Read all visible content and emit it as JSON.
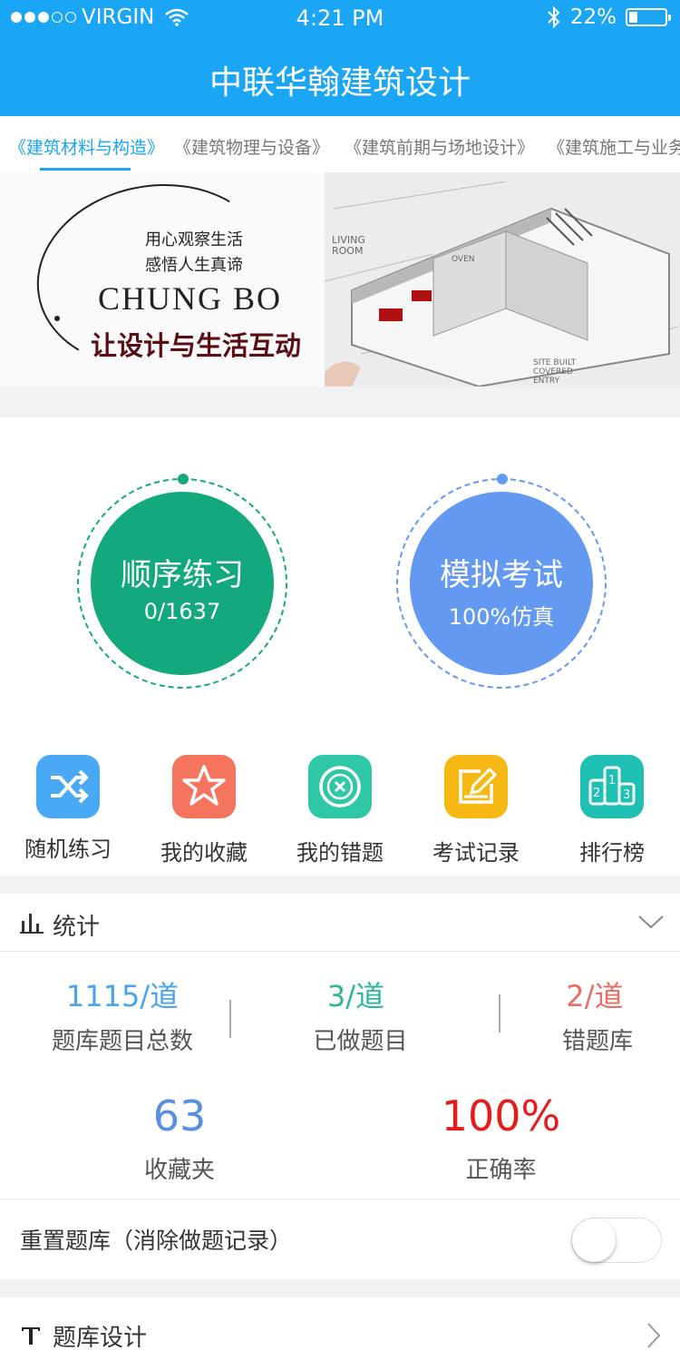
{
  "status_bar": {
    "carrier": "VIRGIN",
    "time": "4:21 PM",
    "battery": "22%"
  },
  "header": {
    "title": "中联华翰建筑设计"
  },
  "tabs": [
    {
      "label": "《建筑材料与构造》",
      "active": true
    },
    {
      "label": "《建筑物理与设备》",
      "active": false
    },
    {
      "label": "《建筑前期与场地设计》",
      "active": false
    },
    {
      "label": "《建筑施工与业务",
      "active": false
    }
  ],
  "banner": {
    "line1": "用心观察生活",
    "line2": "感悟人生真谛",
    "brand": "CHUNG BO",
    "tagline": "让设计与生活互动"
  },
  "practice": {
    "sequential": {
      "label": "顺序练习",
      "progress": "0/1637",
      "color": "#14a87e"
    },
    "mock_exam": {
      "label": "模拟考试",
      "sub": "100%仿真",
      "color": "#6399f0"
    }
  },
  "features": [
    {
      "label": "随机练习",
      "icon": "shuffle-icon",
      "color": "#4aa9f5"
    },
    {
      "label": "我的收藏",
      "icon": "star-icon",
      "color": "#f5745e"
    },
    {
      "label": "我的错题",
      "icon": "close-circle-icon",
      "color": "#2ec8a6"
    },
    {
      "label": "考试记录",
      "icon": "edit-icon",
      "color": "#f6b914"
    },
    {
      "label": "排行榜",
      "icon": "podium-icon",
      "color": "#1ec0b4"
    }
  ],
  "stats": {
    "title": "统计",
    "total": {
      "value": "1115/道",
      "label": "题库题目总数",
      "color": "#4aa3ec"
    },
    "done": {
      "value": "3/道",
      "label": "已做题目",
      "color": "#32b49a"
    },
    "wrong": {
      "value": "2/道",
      "label": "错题库",
      "color": "#ee6b63"
    },
    "favorites": {
      "value": "63",
      "label": "收藏夹",
      "color": "#5a8ee0"
    },
    "accuracy": {
      "value": "100%",
      "label": "正确率",
      "color": "#e61c1c"
    }
  },
  "reset": {
    "label": "重置题库（消除做题记录）",
    "enabled": false
  },
  "design": {
    "label": "题库设计"
  }
}
